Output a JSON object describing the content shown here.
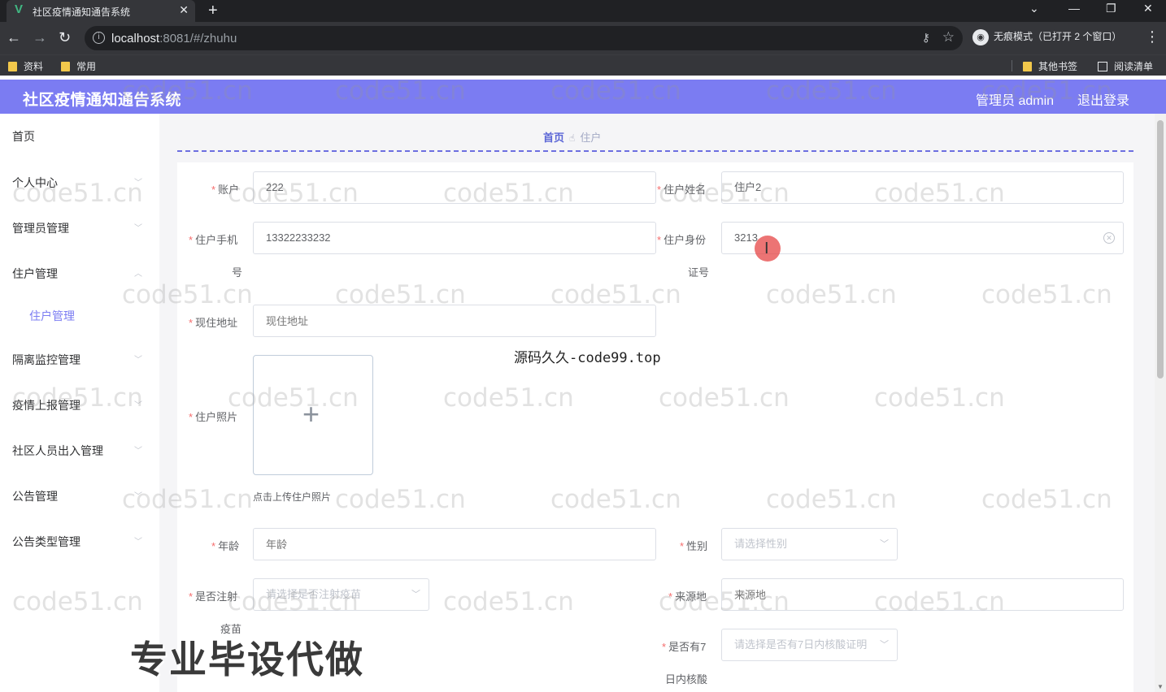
{
  "browser": {
    "tab_title": "社区疫情通知通告系统",
    "tab_favicon": "V",
    "url_host": "localhost",
    "url_rest": ":8081/#/zhuhu",
    "incognito_label": "无痕模式（已打开 2 个窗口）",
    "bookmarks": [
      "资料",
      "常用"
    ],
    "other_bookmarks": "其他书签",
    "reading_list": "阅读清单"
  },
  "header": {
    "title": "社区疫情通知通告系统",
    "admin_label": "管理员 admin",
    "logout_label": "退出登录"
  },
  "sidebar": {
    "items": [
      {
        "label": "首页"
      },
      {
        "label": "个人中心"
      },
      {
        "label": "管理员管理"
      },
      {
        "label": "住户管理"
      },
      {
        "label": "隔离监控管理"
      },
      {
        "label": "疫情上报管理"
      },
      {
        "label": "社区人员出入管理"
      },
      {
        "label": "公告管理"
      },
      {
        "label": "公告类型管理"
      }
    ],
    "subitem_active": "住户管理"
  },
  "breadcrumb": {
    "home": "首页",
    "current": "住户"
  },
  "form": {
    "account_label": "账户",
    "account_value": "222",
    "name_label": "住户姓名",
    "name_value": "住户2",
    "phone_label_1": "住户手机",
    "phone_label_2": "号",
    "phone_value": "13322233232",
    "idcard_label_1": "住户身份",
    "idcard_label_2": "证号",
    "idcard_value": "3213",
    "address_label": "现住地址",
    "address_placeholder": "现住地址",
    "photo_label": "住户照片",
    "photo_tip": "点击上传住户照片",
    "age_label": "年龄",
    "age_placeholder": "年龄",
    "gender_label": "性别",
    "gender_placeholder": "请选择性别",
    "vaccine_label_1": "是否注射",
    "vaccine_label_2": "疫苗",
    "vaccine_placeholder": "请选择是否注射疫苗",
    "origin_label": "来源地",
    "origin_placeholder": "来源地",
    "nucleic_label_1": "是否有7",
    "nucleic_label_2": "日内核酸",
    "nucleic_placeholder": "请选择是否有7日内核酸证明"
  },
  "overlay": {
    "source_text": "源码久久-code99.top",
    "promo_text": "专业毕设代做",
    "watermark": "code51.cn"
  },
  "colors": {
    "header_bg": "#7b7cf2",
    "accent": "#5b66d6",
    "required": "#f56c6c"
  }
}
